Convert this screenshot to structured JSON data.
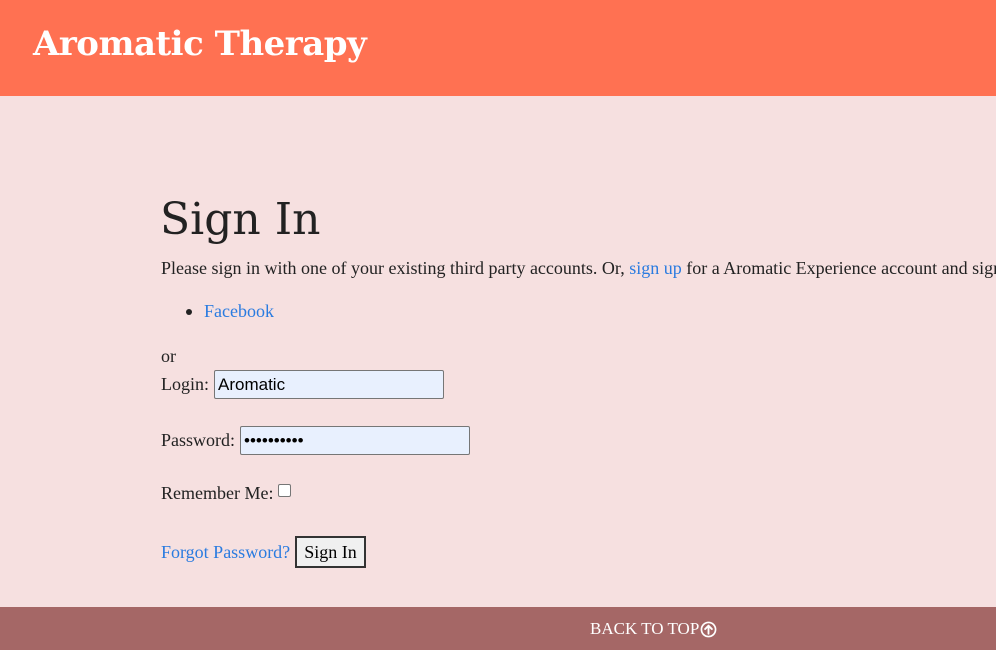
{
  "header": {
    "brand": "Aromatic Therapy"
  },
  "main": {
    "title": "Sign In",
    "intro_before": "Please sign in with one of your existing third party accounts. Or, ",
    "intro_link": "sign up",
    "intro_after": " for a Aromatic Experience account and sign in below:",
    "providers": [
      {
        "label": "Facebook"
      }
    ],
    "or_text": "or",
    "login_label": "Login:",
    "login_value": "Aromatic",
    "password_label": "Password:",
    "password_value": "••••••••••",
    "remember_label": "Remember Me:",
    "remember_checked": false,
    "forgot_label": "Forgot Password?",
    "submit_label": "Sign In"
  },
  "footer": {
    "back_to_top": "BACK TO TOP",
    "back_to_top_icon": "circle-arrow-up-icon"
  },
  "colors": {
    "header_bg": "#ff7152",
    "page_bg": "#f6e0e0",
    "footer_bg": "#a56766",
    "link": "#2a7be0",
    "input_autofill_bg": "#e8f0fe"
  }
}
